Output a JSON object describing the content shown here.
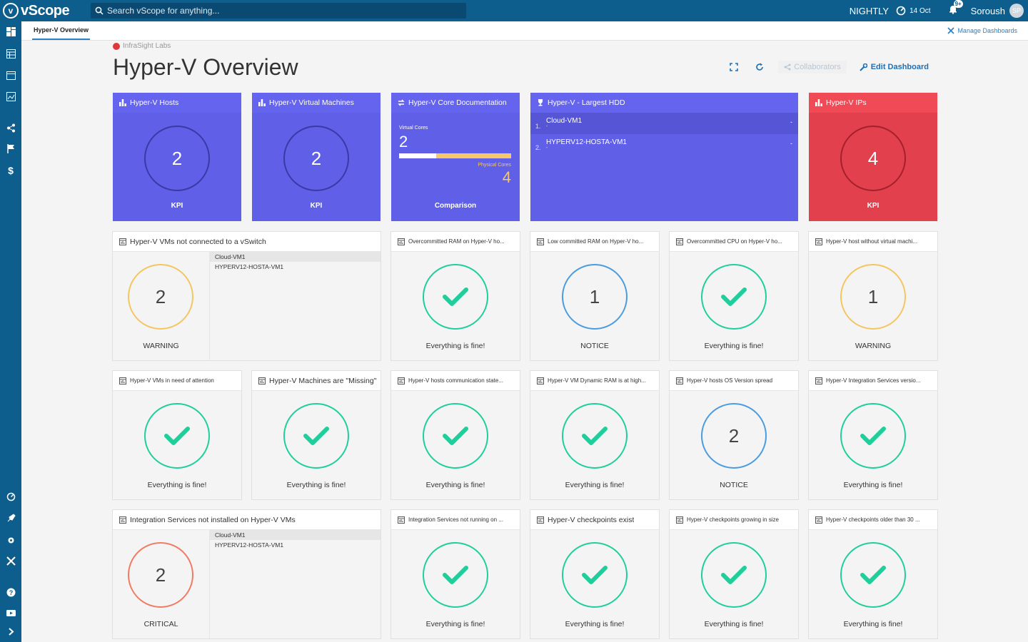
{
  "topbar": {
    "logo_text": "vScope",
    "search_placeholder": "Search vScope for anything...",
    "environment": "NIGHTLY",
    "date": "14 Oct",
    "notif_badge": "9+",
    "user_name": "Soroush",
    "user_initials": "SP"
  },
  "tabs": {
    "active": "Hyper-V Overview",
    "manage_label": "Manage Dashboards"
  },
  "dashboard": {
    "org": "InfraSight Labs",
    "title": "Hyper-V Overview",
    "collaborators_label": "Collaborators",
    "edit_label": "Edit Dashboard"
  },
  "kpis": {
    "hosts": {
      "title": "Hyper-V Hosts",
      "value": "2",
      "label": "KPI"
    },
    "vms": {
      "title": "Hyper-V Virtual Machines",
      "value": "2",
      "label": "KPI"
    },
    "cores": {
      "title": "Hyper-V Core Documentation",
      "virtual_label": "Virtual Cores",
      "virtual_value": "2",
      "physical_label": "Physical Cores",
      "physical_value": "4",
      "label": "Comparison",
      "ratio": 0.33
    },
    "hdd": {
      "title": "Hyper-V - Largest HDD",
      "rows": [
        {
          "index": "1.",
          "name": "Cloud-VM1",
          "sub": "-",
          "value": "-"
        },
        {
          "index": "2.",
          "name": "HYPERV12-HOSTA-VM1",
          "sub": "-",
          "value": "-"
        }
      ]
    },
    "ips": {
      "title": "Hyper-V IPs",
      "value": "4",
      "label": "KPI"
    }
  },
  "checks": {
    "r1": [
      {
        "title": "Hyper-V VMs not connected to a vSwitch",
        "value": "2",
        "label": "WARNING",
        "list": [
          "Cloud-VM1",
          "HYPERV12-HOSTA-VM1"
        ]
      },
      {
        "title": "Overcommitted RAM on Hyper-V ho...",
        "label": "Everything is fine!"
      },
      {
        "title": "Low committed RAM on Hyper-V ho...",
        "value": "1",
        "label": "NOTICE"
      },
      {
        "title": "Overcommitted CPU on Hyper-V ho...",
        "label": "Everything is fine!"
      },
      {
        "title": "Hyper-V host without virtual machi...",
        "value": "1",
        "label": "WARNING"
      }
    ],
    "r2": [
      {
        "title": "Hyper-V VMs in need of attention",
        "label": "Everything is fine!"
      },
      {
        "title": "Hyper-V Machines are \"Missing\"",
        "label": "Everything is fine!"
      },
      {
        "title": "Hyper-V hosts communication state...",
        "label": "Everything is fine!"
      },
      {
        "title": "Hyper-V VM Dynamic RAM is at high...",
        "label": "Everything is fine!"
      },
      {
        "title": "Hyper-V hosts OS Version spread",
        "value": "2",
        "label": "NOTICE"
      },
      {
        "title": "Hyper-V Integration Services versio...",
        "label": "Everything is fine!"
      }
    ],
    "r3": [
      {
        "title": "Integration Services not installed on Hyper-V VMs",
        "value": "2",
        "label": "CRITICAL",
        "list": [
          "Cloud-VM1",
          "HYPERV12-HOSTA-VM1"
        ]
      },
      {
        "title": "Integration Services not running on ...",
        "label": "Everything is fine!"
      },
      {
        "title": "Hyper-V checkpoints exist",
        "label": "Everything is fine!"
      },
      {
        "title": "Hyper-V checkpoints growing in size",
        "label": "Everything is fine!"
      },
      {
        "title": "Hyper-V checkpoints older than 30 ...",
        "label": "Everything is fine!"
      }
    ]
  },
  "colors": {
    "brand": "#0e5e8d",
    "kpi_blue": "#5f5fe8",
    "kpi_red": "#e2404c",
    "ok": "#1ecf9b",
    "warning": "#f4c661",
    "notice": "#4a9ce0",
    "critical": "#f07b62"
  }
}
